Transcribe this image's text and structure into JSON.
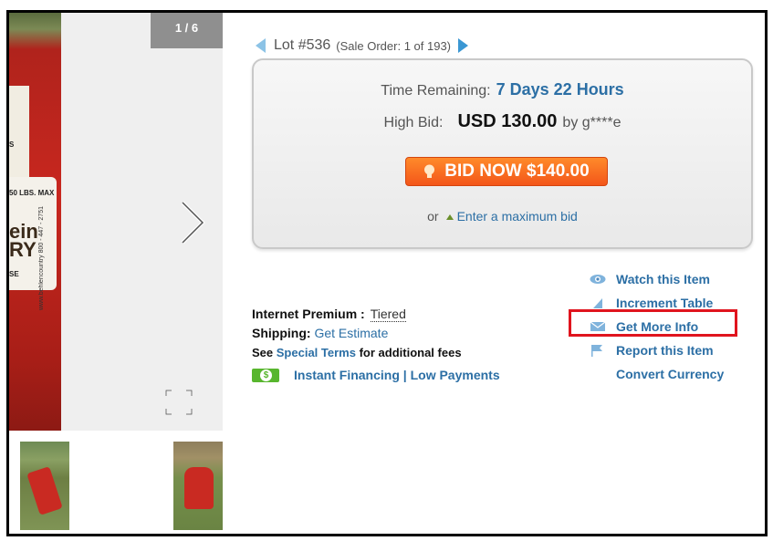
{
  "gallery": {
    "counter": "1 / 6",
    "photo_text": {
      "lbs": "50 LBS. MAX",
      "brand": "ein\nRY",
      "url": "www.behlencountry 800 - 447 - 2751",
      "s": "S",
      "se": "SE"
    }
  },
  "lot": {
    "label": "Lot #536",
    "sale_order": "(Sale Order: 1 of 193)"
  },
  "bid_box": {
    "time_label": "Time Remaining:",
    "time_value": "7 Days 22 Hours",
    "high_bid_label": "High Bid:",
    "high_bid_value": "USD 130.00",
    "high_bid_by": "by g****e",
    "bid_button": "BID NOW $140.00",
    "or": "or",
    "max_bid_link": "Enter a maximum bid"
  },
  "info": {
    "premium_label": "Internet Premium :",
    "premium_value": "Tiered",
    "shipping_label": "Shipping:",
    "shipping_link": "Get Estimate",
    "see": "See",
    "special_terms": "Special Terms",
    "additional_fees": "for additional fees",
    "financing": "Instant Financing | Low Payments",
    "money_symbol": "$"
  },
  "actions": [
    {
      "label": "Watch this Item",
      "icon": "eye-icon"
    },
    {
      "label": "Increment Table",
      "icon": "signal-bars-icon"
    },
    {
      "label": "Get More Info",
      "icon": "envelope-icon"
    },
    {
      "label": "Report this Item",
      "icon": "flag-icon"
    },
    {
      "label": "Convert Currency",
      "icon": "none"
    }
  ],
  "colors": {
    "link": "#2c6fa5",
    "bid_button": "#f3561a",
    "highlight": "#e0141e",
    "money": "#58b62e"
  }
}
